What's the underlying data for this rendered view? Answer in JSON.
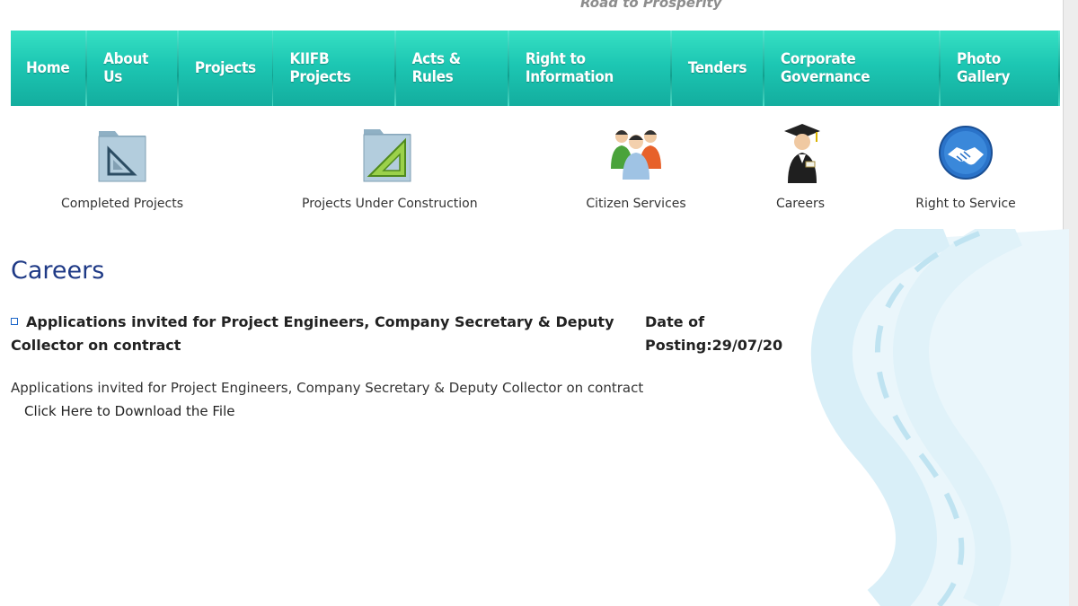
{
  "header": {
    "tagline": "Road to Prosperity"
  },
  "nav": {
    "items": [
      {
        "label": "Home"
      },
      {
        "label": "About Us"
      },
      {
        "label": "Projects"
      },
      {
        "label": "KIIFB Projects"
      },
      {
        "label": "Acts & Rules"
      },
      {
        "label": "Right to Information"
      },
      {
        "label": "Tenders"
      },
      {
        "label": "Corporate Governance"
      },
      {
        "label": "Photo Gallery"
      }
    ]
  },
  "quicklinks": [
    {
      "label": "Completed Projects",
      "icon": "folder-set-square-icon"
    },
    {
      "label": "Projects Under Construction",
      "icon": "folder-triangle-ruler-icon"
    },
    {
      "label": "Citizen Services",
      "icon": "people-group-icon"
    },
    {
      "label": "Careers",
      "icon": "graduate-icon"
    },
    {
      "label": "Right to Service",
      "icon": "handshake-icon"
    }
  ],
  "careers": {
    "title": "Careers",
    "post_title": "Applications invited for Project Engineers, Company Secretary & Deputy Collector on contract",
    "date_label": "Date of Posting:29/07/20",
    "description": "Applications invited for Project Engineers, Company Secretary & Deputy Collector on contract",
    "download_label": "Click Here to Download the File"
  },
  "colors": {
    "nav_top": "#36e0c3",
    "nav_bottom": "#13ad9e",
    "title": "#1f3a86",
    "bullet": "#1c66c9"
  }
}
